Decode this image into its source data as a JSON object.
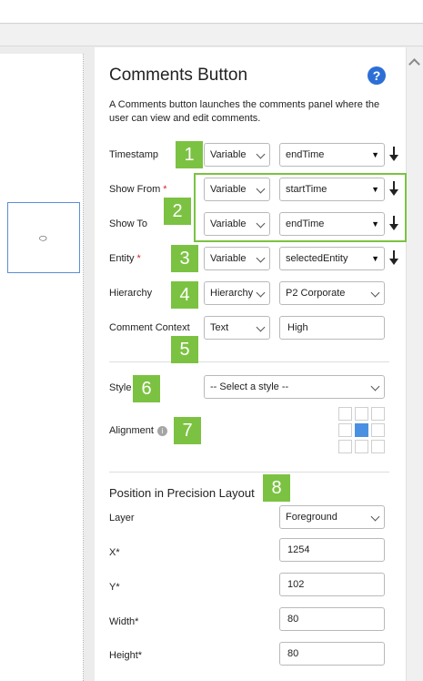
{
  "panel": {
    "title": "Comments Button",
    "help_icon": "?",
    "description": "A Comments button launches the comments panel where the user can view and edit comments."
  },
  "canvas": {
    "widget_icon": "comment-bubble-icon",
    "widget_glyph": "⬭"
  },
  "fields": {
    "timestamp": {
      "label": "Timestamp",
      "type": "Variable",
      "value": "endTime"
    },
    "show_from": {
      "label": "Show From",
      "required": "*",
      "type": "Variable",
      "value": "startTime"
    },
    "show_to": {
      "label": "Show To",
      "type": "Variable",
      "value": "endTime"
    },
    "entity": {
      "label": "Entity",
      "required": "*",
      "type": "Variable",
      "value": "selectedEntity"
    },
    "hierarchy": {
      "label": "Hierarchy",
      "type": "Hierarchy",
      "value": "P2 Corporate"
    },
    "comment_context": {
      "label": "Comment Context",
      "type": "Text",
      "value": "High"
    }
  },
  "style": {
    "label": "Style",
    "placeholder": "-- Select a style --"
  },
  "alignment": {
    "label": "Alignment",
    "info_icon": "i",
    "selected_cell": "middle-center"
  },
  "precision_layout": {
    "title": "Position in Precision Layout",
    "layer": {
      "label": "Layer",
      "value": "Foreground"
    },
    "x": {
      "label": "X*",
      "value": "1254"
    },
    "y": {
      "label": "Y*",
      "value": "102"
    },
    "width": {
      "label": "Width*",
      "value": "80"
    },
    "height": {
      "label": "Height*",
      "value": "80"
    }
  },
  "callouts": [
    "1",
    "2",
    "3",
    "4",
    "5",
    "6",
    "7",
    "8"
  ],
  "colors": {
    "callout_green": "#7cc242",
    "help_blue": "#2b6fd6",
    "required_red": "#d9262c",
    "selected_cell_blue": "#4a90e2"
  }
}
